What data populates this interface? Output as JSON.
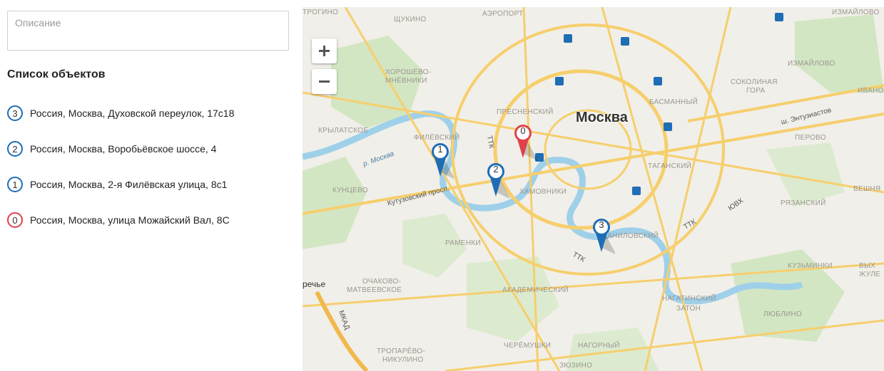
{
  "description": {
    "placeholder": "Описание"
  },
  "list_title": "Список объектов",
  "objects": [
    {
      "number": "3",
      "address": "Россия, Москва, Духовской переулок, 17с18",
      "color": "#1e6db5"
    },
    {
      "number": "2",
      "address": "Россия, Москва, Воробьёвское шоссе, 4",
      "color": "#1e6db5"
    },
    {
      "number": "1",
      "address": "Россия, Москва, 2-я Филёвская улица, 8с1",
      "color": "#1e6db5"
    },
    {
      "number": "0",
      "address": "Россия, Москва, улица Можайский Вал, 8С",
      "color": "#e0414a"
    }
  ],
  "map": {
    "city": "Москва",
    "districts": {
      "d1": "ТРОГИНО",
      "d2": "ЩУКИНО",
      "d3": "АЭРОПОРТ",
      "d4": "ИЗМАЙЛОВО",
      "d5": "ХОРОШЁВО-",
      "d6": "МНЁВНИКИ",
      "d7": "ИЗМАЙЛОВО",
      "d8": "СОКОЛИНАЯ",
      "d9": "ГОРА",
      "d10": "ИВАНО",
      "d11": "ПРЕСНЕНСКИЙ",
      "d12": "БАСМАННЫЙ",
      "d13": "КРЫЛАТСКОЕ",
      "d14": "ФИЛЁВСКИЙ",
      "d15": "ПЕРОВО",
      "d16": "ТАГАНСКИЙ",
      "d17": "КУНЦЕВО",
      "d18": "ХАМОВНИКИ",
      "d19": "РЯЗАНСКИЙ",
      "d20": "ВЕШНЯ",
      "d21": "ДАНИЛОВСКИЙ",
      "d22": "РАМЕНКИ",
      "d23": "КУЗЬМИНКИ",
      "d24": "ВЫХ",
      "d25": "ЖУЛЕ",
      "d26": "ОЧАКОВО-",
      "d27": "МАТВЕЕВСКОЕ",
      "d28": "АКАДЕМИЧЕСКИЙ",
      "d29": "НАГАТИНСКИЙ",
      "d30": "ЗАТОН",
      "d31": "ЛЮБЛИНО",
      "d32": "ТРОПАРЁВО-",
      "d33": "НИКУЛИНО",
      "d34": "ЧЕРЁМУШКИ",
      "d35": "НАГОРНЫЙ",
      "d36": "ЗЮЗИНО"
    },
    "roads": {
      "kutuzovsky": "Кутузовский просп.",
      "moskva_river": "р. Москва",
      "ttk1": "ТТК",
      "ttk2": "ТТК",
      "ttk3": "ТТК",
      "yuvh": "ЮВХ",
      "entuziastov": "ш. Энтузиастов",
      "mkad": "МКАД",
      "rechye": "речье"
    },
    "markers": [
      {
        "number": "0",
        "color": "#e0414a"
      },
      {
        "number": "1",
        "color": "#1e6db5"
      },
      {
        "number": "2",
        "color": "#1e6db5"
      },
      {
        "number": "3",
        "color": "#1e6db5"
      }
    ]
  }
}
